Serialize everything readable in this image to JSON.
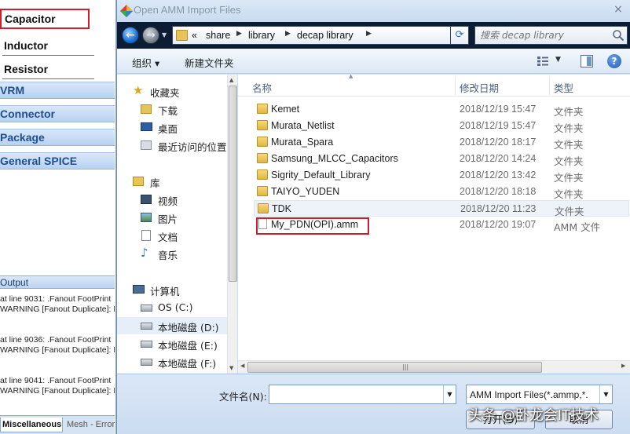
{
  "left_panel": {
    "library_items": [
      "Capacitor",
      "Inductor",
      "Resistor"
    ],
    "groups": [
      "VRM",
      "Connector",
      "Package",
      "General SPICE"
    ],
    "output_title": "Output",
    "output_lines": [
      "at line 9031: .Fanout FootPrint",
      "WARNING [Fanout Duplicate]: D",
      "at line 9036: .Fanout FootPrint",
      "WARNING [Fanout Duplicate]: D",
      "at line 9041: .Fanout FootPrint",
      "WARNING [Fanout Duplicate]: D"
    ],
    "bottom_tabs": [
      "Miscellaneous",
      "Mesh - Error"
    ]
  },
  "dialog": {
    "title": "Open AMM Import Files",
    "close_glyph": "×",
    "address": {
      "overflow": "«",
      "crumbs": [
        "share",
        "library",
        "decap library"
      ]
    },
    "search_placeholder": "搜索 decap library",
    "toolbar": {
      "organize": "组织 ▾",
      "new_folder": "新建文件夹"
    },
    "nav": {
      "favorites": "收藏夹",
      "downloads": "下载",
      "desktop": "桌面",
      "recent": "最近访问的位置",
      "libraries": "库",
      "videos": "视频",
      "pictures": "图片",
      "documents": "文档",
      "music": "音乐",
      "computer": "计算机",
      "drive_c": "OS (C:)",
      "drive_d": "本地磁盘 (D:)",
      "drive_e": "本地磁盘 (E:)",
      "drive_f": "本地磁盘 (F:)"
    },
    "columns": {
      "name": "名称",
      "date": "修改日期",
      "type": "类型"
    },
    "files": [
      {
        "name": "Kemet",
        "date": "2018/12/19 15:47",
        "type": "文件夹",
        "kind": "folder"
      },
      {
        "name": "Murata_Netlist",
        "date": "2018/12/19 15:47",
        "type": "文件夹",
        "kind": "folder"
      },
      {
        "name": "Murata_Spara",
        "date": "2018/12/20 18:17",
        "type": "文件夹",
        "kind": "folder"
      },
      {
        "name": "Samsung_MLCC_Capacitors",
        "date": "2018/12/20 14:24",
        "type": "文件夹",
        "kind": "folder"
      },
      {
        "name": "Sigrity_Default_Library",
        "date": "2018/12/20 13:42",
        "type": "文件夹",
        "kind": "folder"
      },
      {
        "name": "TAIYO_YUDEN",
        "date": "2018/12/20 18:18",
        "type": "文件夹",
        "kind": "folder"
      },
      {
        "name": "TDK",
        "date": "2018/12/20 11:23",
        "type": "文件夹",
        "kind": "folder"
      },
      {
        "name": "My_PDN(OPI).amm",
        "date": "2018/12/20 19:07",
        "type": "AMM 文件",
        "kind": "file"
      }
    ],
    "filename_label": "文件名(N):",
    "filename_value": "",
    "filetype_value": "AMM Import Files(*.ammp,*.",
    "open_label": "打开(O)",
    "cancel_label": "取消"
  },
  "watermark": "头条 @卧龙会IT技术",
  "colors": {
    "highlight_red": "#cc1f2e",
    "nav_dark": "#0c1d33",
    "group_blue": "#1f4f8f"
  }
}
